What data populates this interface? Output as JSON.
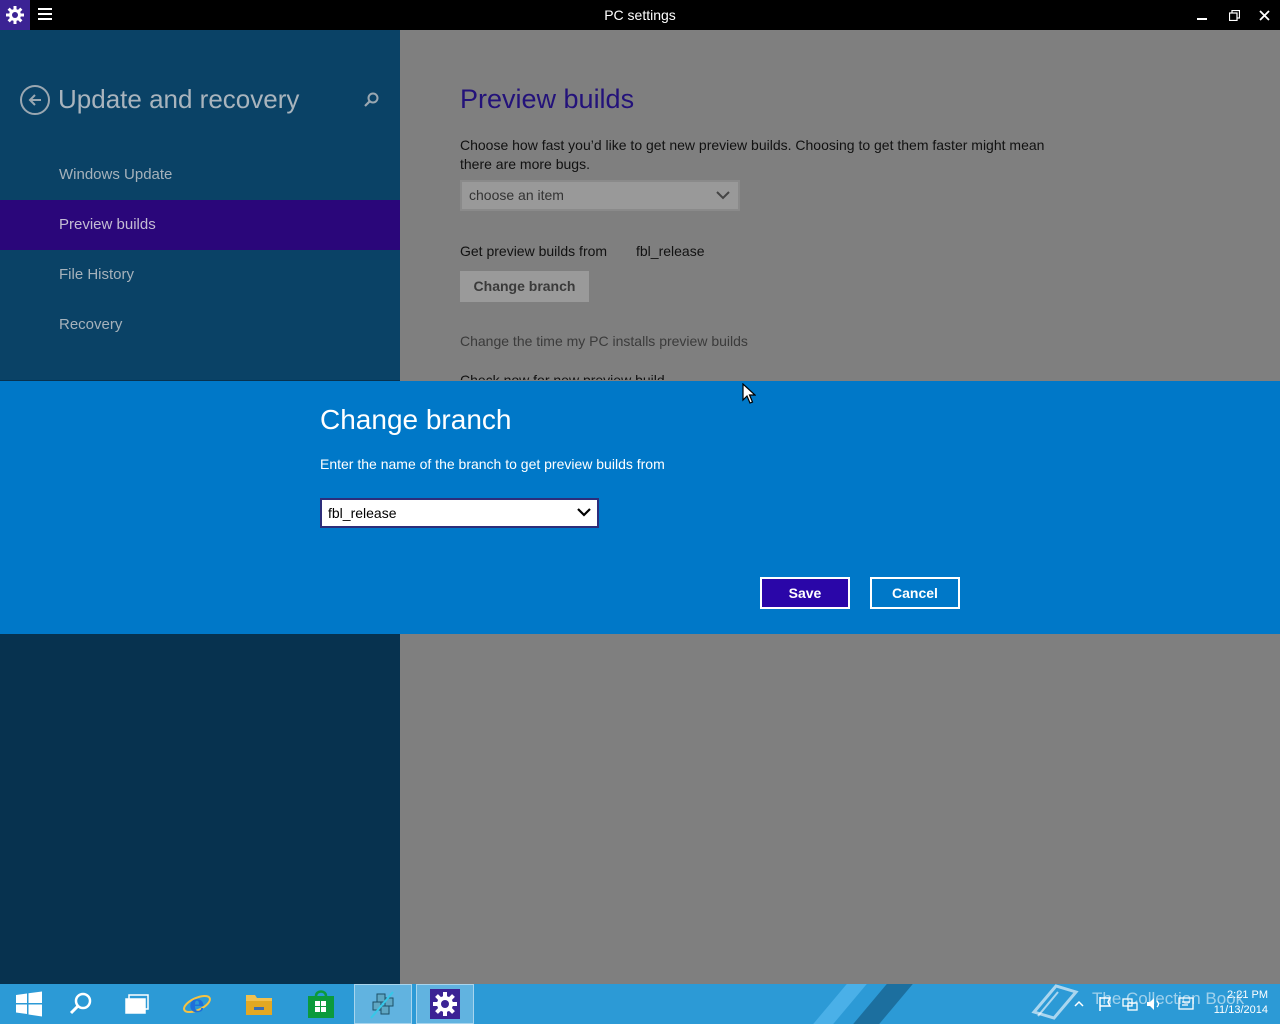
{
  "window": {
    "title": "PC settings",
    "minimize_label": "−",
    "restore_label": "❐",
    "close_label": "✕"
  },
  "sidebar": {
    "title": "Update and recovery",
    "items": [
      {
        "label": "Windows Update",
        "active": false
      },
      {
        "label": "Preview builds",
        "active": true
      },
      {
        "label": "File History",
        "active": false
      },
      {
        "label": "Recovery",
        "active": false
      }
    ]
  },
  "main": {
    "title": "Preview builds",
    "description": "Choose how fast you’d like to get new preview builds. Choosing to get them faster might mean there are more bugs.",
    "speed_select_placeholder": "choose an item",
    "branch_label": "Get preview builds from",
    "branch_value": "fbl_release",
    "change_branch_button": "Change branch",
    "change_time_link": "Change the time my PC installs preview builds",
    "check_now_link": "Check now for new preview build"
  },
  "dialog": {
    "title": "Change branch",
    "description": "Enter the name of the branch to get preview builds from",
    "branch_value": "fbl_release",
    "save_label": "Save",
    "cancel_label": "Cancel"
  },
  "taskbar": {
    "watermark": "The Collection Book",
    "time": "2:21 PM",
    "date": "11/13/2014"
  },
  "colors": {
    "sidebar_active": "#2a067a",
    "dialog_band": "#0078c8",
    "save_button": "#2a06a8",
    "taskbar": "#2c9ad6"
  }
}
